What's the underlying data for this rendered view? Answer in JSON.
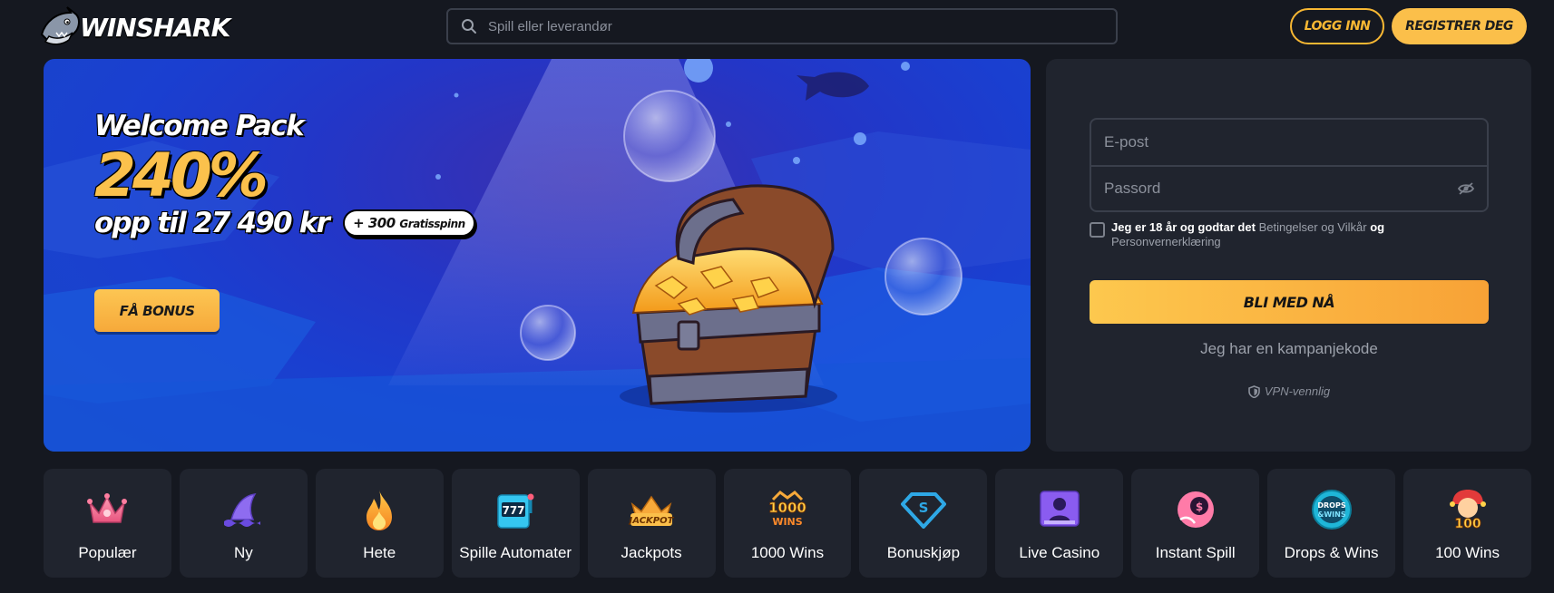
{
  "header": {
    "logo_text": "WINSHARK",
    "search_placeholder": "Spill eller leverandør",
    "login_label": "LOGG INN",
    "register_label": "REGISTRER DEG"
  },
  "banner": {
    "title": "Welcome Pack",
    "percent": "240%",
    "amount": "opp til 27 490 kr",
    "spins_count": "+ 300",
    "spins_label": "Gratisspinn",
    "cta_label": "FÅ BONUS"
  },
  "signup": {
    "email_placeholder": "E-post",
    "password_placeholder": "Passord",
    "terms_prefix": "Jeg er 18 år og godtar det",
    "terms_link": "Betingelser og Vilkår",
    "terms_and": "og",
    "privacy_link": "Personvernerklæring",
    "join_label": "BLI MED NÅ",
    "promo_code_label": "Jeg har en kampanjekode",
    "vpn_label": "VPN-vennlig"
  },
  "categories": [
    {
      "label": "Populær",
      "icon": "crown-icon"
    },
    {
      "label": "Ny",
      "icon": "shark-fin-icon"
    },
    {
      "label": "Hete",
      "icon": "flame-icon"
    },
    {
      "label": "Spille Automater",
      "icon": "slot-machine-icon"
    },
    {
      "label": "Jackpots",
      "icon": "jackpot-crown-icon"
    },
    {
      "label": "1000 Wins",
      "icon": "1000-wins-icon"
    },
    {
      "label": "Bonuskjøp",
      "icon": "diamond-s-icon"
    },
    {
      "label": "Live Casino",
      "icon": "live-dealer-icon"
    },
    {
      "label": "Instant Spill",
      "icon": "instant-coin-icon"
    },
    {
      "label": "Drops & Wins",
      "icon": "drops-wins-icon"
    },
    {
      "label": "100 Wins",
      "icon": "jester-100-icon"
    }
  ],
  "colors": {
    "accent": "#fbbf4a",
    "background": "#151820",
    "panel": "#20242e"
  }
}
